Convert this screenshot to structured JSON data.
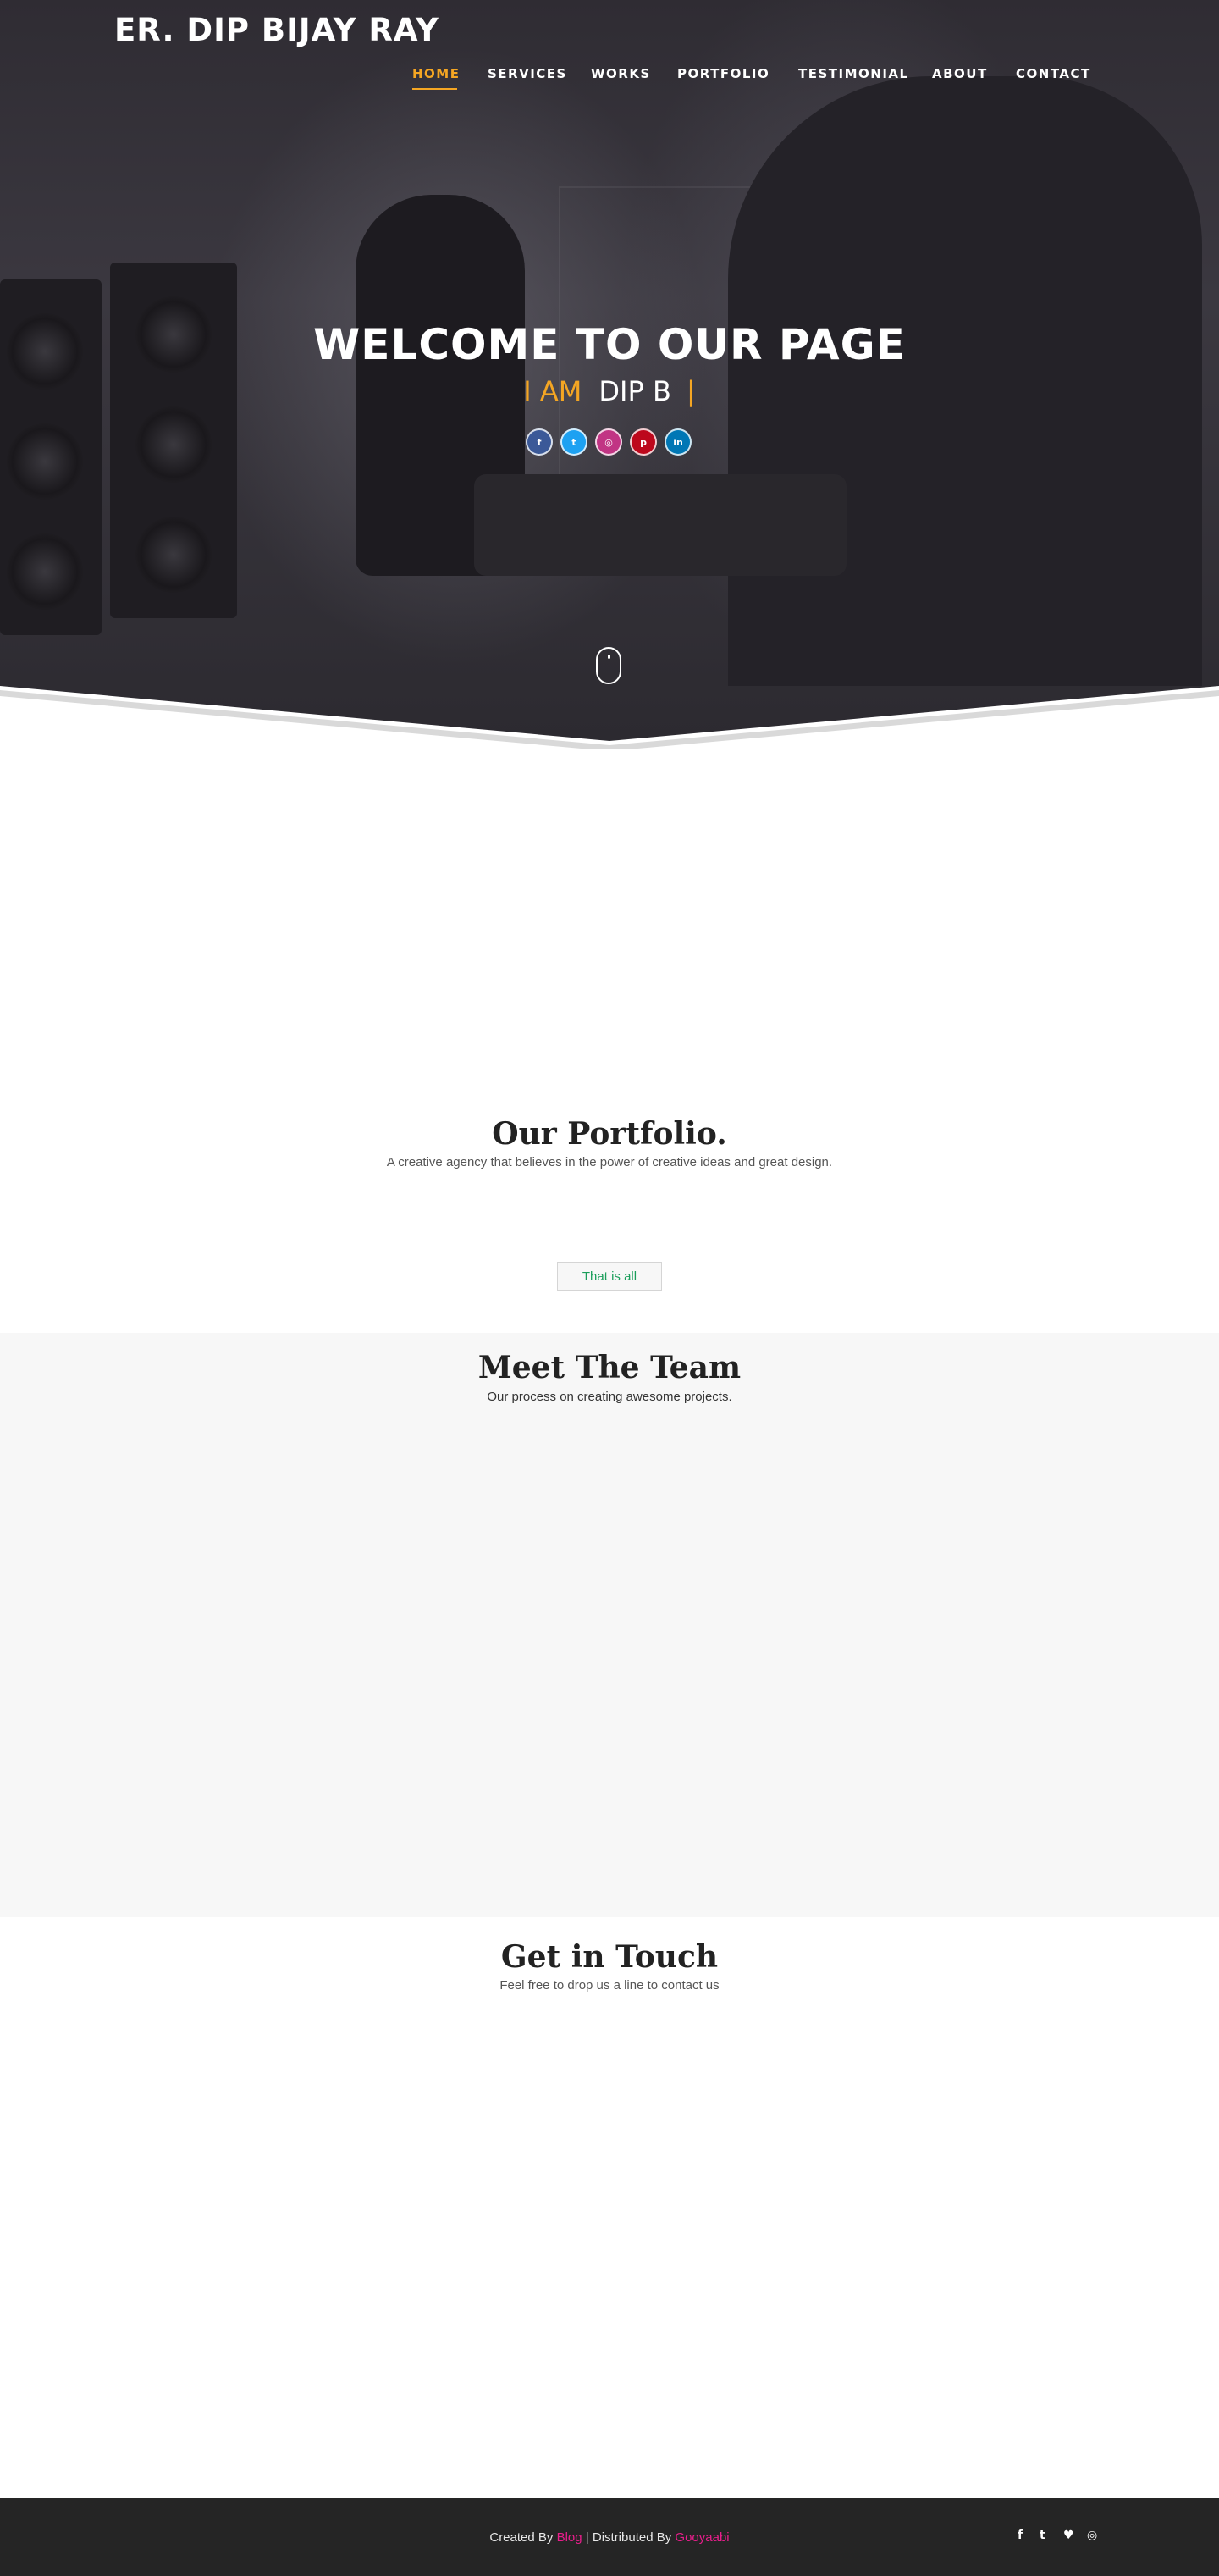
{
  "site": {
    "logo": "ER. DIP BIJAY RAY"
  },
  "nav": {
    "items": [
      {
        "label": "HOME",
        "active": true
      },
      {
        "label": "SERVICES",
        "active": false
      },
      {
        "label": "WORKS",
        "active": false
      },
      {
        "label": "PORTFOLIO",
        "active": false
      },
      {
        "label": "TESTIMONIAL",
        "active": false
      },
      {
        "label": "ABOUT",
        "active": false
      },
      {
        "label": "CONTACT",
        "active": false
      }
    ]
  },
  "hero": {
    "title": "WELCOME TO OUR PAGE",
    "prefix": "I AM",
    "name": "DIP B",
    "cursor": "|",
    "social": [
      {
        "icon": "facebook-icon",
        "glyph": "f",
        "color": "#3b5998"
      },
      {
        "icon": "twitter-icon",
        "glyph": "t",
        "color": "#1da1f2"
      },
      {
        "icon": "instagram-icon",
        "glyph": "◎",
        "color": "#c13584"
      },
      {
        "icon": "pinterest-icon",
        "glyph": "p",
        "color": "#bd081c"
      },
      {
        "icon": "linkedin-icon",
        "glyph": "in",
        "color": "#0077b5"
      }
    ],
    "scroll_icon": "mouse-scroll-icon"
  },
  "portfolio": {
    "title": "Our Portfolio.",
    "subtitle": "A creative agency that believes in the power of creative ideas and great design.",
    "button": "That is all"
  },
  "team": {
    "title": "Meet The Team",
    "subtitle": "Our process on creating awesome projects."
  },
  "contact": {
    "title": "Get in Touch",
    "subtitle": "Feel free to drop us a line to contact us"
  },
  "footer": {
    "created_by": "Created By",
    "blog_link": "Blog",
    "separator": "|",
    "distributed_by": "Distributed By",
    "distributor_link": "Gooyaabi",
    "social": [
      {
        "icon": "facebook-icon",
        "glyph": "f"
      },
      {
        "icon": "twitter-icon",
        "glyph": "t"
      },
      {
        "icon": "heart-icon",
        "glyph": "♥"
      },
      {
        "icon": "instagram-icon",
        "glyph": "◎"
      }
    ]
  },
  "colors": {
    "accent": "#f5a623",
    "link": "#e91e8c",
    "button_text": "#1a9e5a",
    "footer_bg": "#252525",
    "team_bg": "#f7f7f7"
  }
}
